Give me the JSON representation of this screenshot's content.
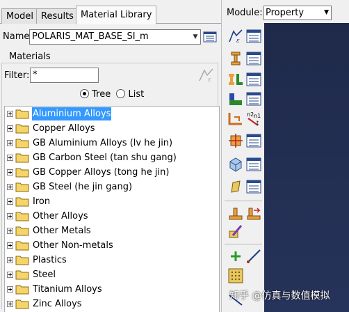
{
  "tabs": [
    "Model",
    "Results",
    "Material Library"
  ],
  "active_tab": "Material Library",
  "name_label": "Name:",
  "name_value": "POLARIS_MAT_BASE_SI_m",
  "materials_group": "Materials",
  "filter_label": "Filter:",
  "filter_value": "*",
  "view_options": [
    "Tree",
    "List"
  ],
  "view_selected": "Tree",
  "tree_items": [
    "Aluminium Alloys",
    "Copper Alloys",
    "GB Aluminium Alloys (lv he jin)",
    "GB Carbon Steel (tan shu gang)",
    "GB Copper Alloys (tong he jin)",
    "GB Steel (he jin gang)",
    "Iron",
    "Other Alloys",
    "Other Metals",
    "Other Non-metals",
    "Plastics",
    "Steel",
    "Titanium Alloys",
    "Zinc Alloys"
  ],
  "selected_item": "Aluminium Alloys",
  "module_label": "Module:",
  "module_value": "Property",
  "watermark": "知乎 @仿真与数值模拟",
  "colors": {
    "selection": "#3399ff",
    "folder": "#f5d56a",
    "viewport": "#1f2a4a"
  }
}
